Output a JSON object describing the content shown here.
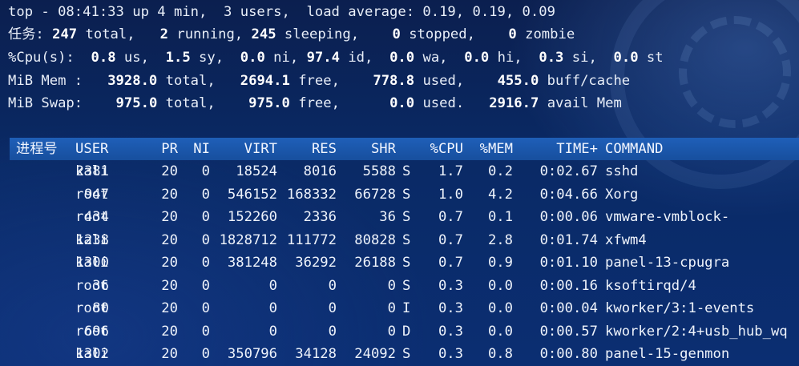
{
  "summary": {
    "line1": "top - 08:41:33 up 4 min,  3 users,  load average: 0.19, 0.19, 0.09",
    "tasks_label": "任务:",
    "tasks_total": "247",
    "tasks_total_label": "total,",
    "tasks_running": "2",
    "tasks_running_label": "running,",
    "tasks_sleeping": "245",
    "tasks_sleeping_label": "sleeping,",
    "tasks_stopped": "0",
    "tasks_stopped_label": "stopped,",
    "tasks_zombie": "0",
    "tasks_zombie_label": "zombie",
    "cpu_label": "%Cpu(s):",
    "cpu_us": "0.8",
    "cpu_sy": "1.5",
    "cpu_ni": "0.0",
    "cpu_id": "97.4",
    "cpu_wa": "0.0",
    "cpu_hi": "0.0",
    "cpu_si": "0.3",
    "cpu_st": "0.0",
    "mem_label": "MiB Mem :",
    "mem_total": "3928.0",
    "mem_free": "2694.1",
    "mem_used": "778.8",
    "mem_buff": "455.0",
    "swap_label": "MiB Swap:",
    "swap_total": "975.0",
    "swap_free": "975.0",
    "swap_used": "0.0",
    "swap_avail": "2916.7"
  },
  "columns": {
    "pid": "进程号",
    "user": "USER",
    "pr": "PR",
    "ni": "NI",
    "virt": "VIRT",
    "res": "RES",
    "shr": "SHR",
    "s": "",
    "cpu": "%CPU",
    "mem": "%MEM",
    "time": "TIME+",
    "command": "COMMAND"
  },
  "processes": [
    {
      "pid": "2381",
      "user": "kali",
      "pr": "20",
      "ni": "0",
      "virt": "18524",
      "res": "8016",
      "shr": "5588",
      "s": "S",
      "cpu": "1.7",
      "mem": "0.2",
      "time": "0:02.67",
      "command": "sshd"
    },
    {
      "pid": "947",
      "user": "root",
      "pr": "20",
      "ni": "0",
      "virt": "546152",
      "res": "168332",
      "shr": "66728",
      "s": "S",
      "cpu": "1.0",
      "mem": "4.2",
      "time": "0:04.66",
      "command": "Xorg"
    },
    {
      "pid": "434",
      "user": "root",
      "pr": "20",
      "ni": "0",
      "virt": "152260",
      "res": "2336",
      "shr": "36",
      "s": "S",
      "cpu": "0.7",
      "mem": "0.1",
      "time": "0:00.06",
      "command": "vmware-vmblock-"
    },
    {
      "pid": "1238",
      "user": "kali",
      "pr": "20",
      "ni": "0",
      "virt": "1828712",
      "res": "111772",
      "shr": "80828",
      "s": "S",
      "cpu": "0.7",
      "mem": "2.8",
      "time": "0:01.74",
      "command": "xfwm4"
    },
    {
      "pid": "1300",
      "user": "kali",
      "pr": "20",
      "ni": "0",
      "virt": "381248",
      "res": "36292",
      "shr": "26188",
      "s": "S",
      "cpu": "0.7",
      "mem": "0.9",
      "time": "0:01.10",
      "command": "panel-13-cpugra"
    },
    {
      "pid": "36",
      "user": "root",
      "pr": "20",
      "ni": "0",
      "virt": "0",
      "res": "0",
      "shr": "0",
      "s": "S",
      "cpu": "0.3",
      "mem": "0.0",
      "time": "0:00.16",
      "command": "ksoftirqd/4"
    },
    {
      "pid": "80",
      "user": "root",
      "pr": "20",
      "ni": "0",
      "virt": "0",
      "res": "0",
      "shr": "0",
      "s": "I",
      "cpu": "0.3",
      "mem": "0.0",
      "time": "0:00.04",
      "command": "kworker/3:1-events"
    },
    {
      "pid": "696",
      "user": "root",
      "pr": "20",
      "ni": "0",
      "virt": "0",
      "res": "0",
      "shr": "0",
      "s": "D",
      "cpu": "0.3",
      "mem": "0.0",
      "time": "0:00.57",
      "command": "kworker/2:4+usb_hub_wq"
    },
    {
      "pid": "1302",
      "user": "kali",
      "pr": "20",
      "ni": "0",
      "virt": "350796",
      "res": "34128",
      "shr": "24092",
      "s": "S",
      "cpu": "0.3",
      "mem": "0.8",
      "time": "0:00.80",
      "command": "panel-15-genmon"
    }
  ]
}
